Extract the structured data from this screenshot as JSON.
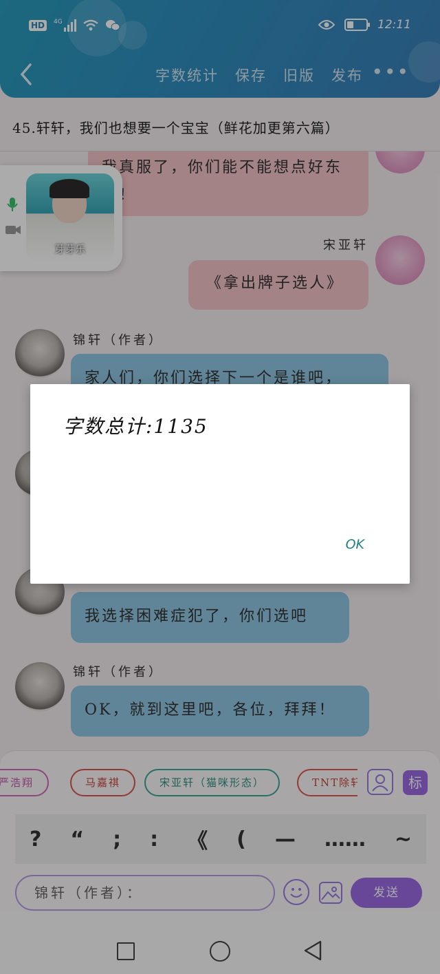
{
  "status_bar": {
    "hd": "HD",
    "network": "4G",
    "time": "12:11"
  },
  "header": {
    "actions": [
      "字数统计",
      "保存",
      "旧版",
      "发布"
    ],
    "more": "•••"
  },
  "story_title": "45.轩轩，我们也想要一个宝宝（鲜花加更第六篇）",
  "video_call": {
    "caption": "芽芽乐"
  },
  "messages": {
    "m1_text": "我真服了，你们能不能想点好东西！",
    "m2_name": "宋亚轩",
    "m2_text": "《拿出牌子选人》",
    "m3_name": "锦轩（作者）",
    "m3_text": "家人们，你们选择下一个是谁吧，",
    "m4_text": "我选择困难症犯了，你们选吧",
    "m5_name": "锦轩（作者）",
    "m5_text": "OK，就到这里吧，各位，拜拜！"
  },
  "chips": [
    "严浩翔",
    "马嘉祺",
    "宋亚轩（猫咪形态）",
    "TNT除轩"
  ],
  "tag_button": "标",
  "punctuation": [
    "?",
    "“",
    ";",
    ":",
    "《",
    "(",
    "—",
    "……",
    "~"
  ],
  "input": {
    "value": "锦轩（作者）："
  },
  "send_label": "发送",
  "dialog": {
    "message": "字数总计:1135",
    "ok_label": "OK"
  },
  "colors": {
    "header_gradient_start": "#2a9bbd",
    "accent_purple": "#9b6be5",
    "pink_bubble": "#f4c3c7",
    "blue_bubble": "#8fc6e3",
    "ok_teal": "#1f7f84"
  }
}
